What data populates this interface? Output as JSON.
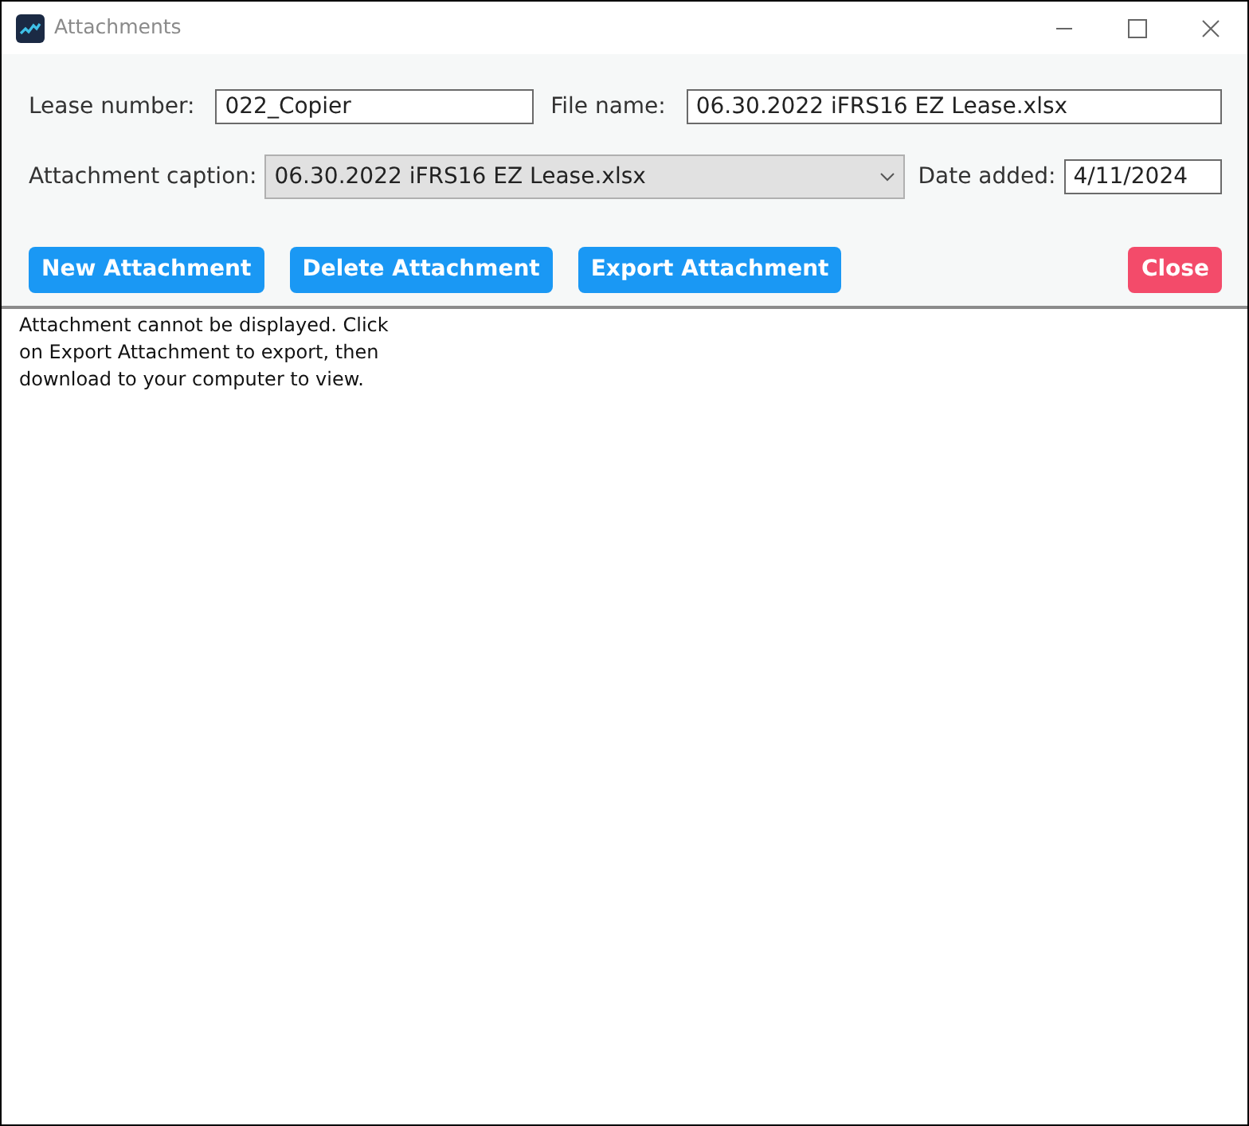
{
  "window": {
    "title": "Attachments"
  },
  "form": {
    "lease_number": {
      "label": "Lease number:",
      "value": "022_Copier"
    },
    "file_name": {
      "label": "File name:",
      "value": "06.30.2022 iFRS16 EZ Lease.xlsx"
    },
    "attachment_caption": {
      "label": "Attachment caption:",
      "value": "06.30.2022 iFRS16 EZ Lease.xlsx"
    },
    "date_added": {
      "label": "Date added:",
      "value": "4/11/2024"
    }
  },
  "buttons": [
    {
      "label": "New Attachment",
      "kind": "primary"
    },
    {
      "label": "Delete Attachment",
      "kind": "primary"
    },
    {
      "label": "Export Attachment",
      "kind": "primary"
    },
    {
      "label": "Close",
      "kind": "danger"
    }
  ],
  "viewer": {
    "message": "Attachment cannot be displayed. Click on Export Attachment to export, then download to your computer to view."
  }
}
